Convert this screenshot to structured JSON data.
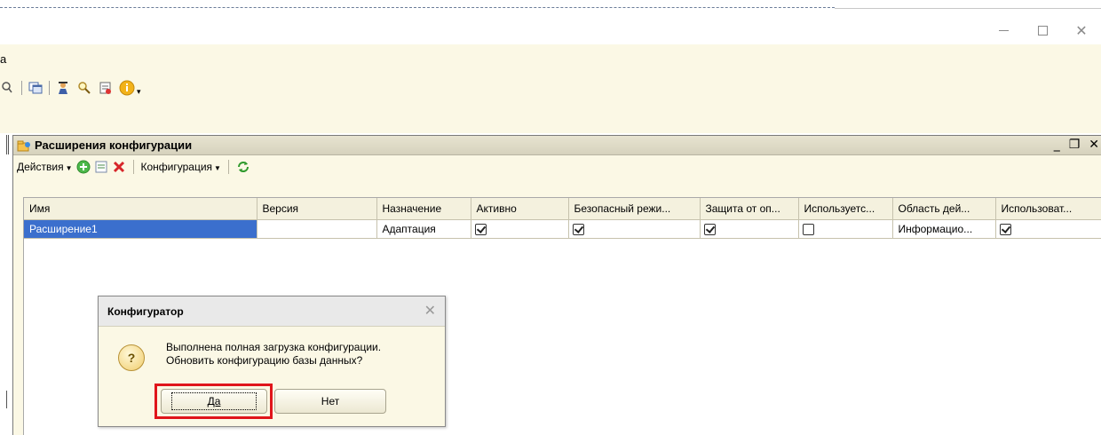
{
  "app": {
    "menu_fragment": "а"
  },
  "extensions_window": {
    "title": "Расширения конфигурации",
    "toolbar": {
      "actions_label": "Действия",
      "configuration_label": "Конфигурация"
    },
    "columns": [
      "Имя",
      "Версия",
      "Назначение",
      "Активно",
      "Безопасный режи...",
      "Защита от оп...",
      "Используетс...",
      "Область дей...",
      "Использоват..."
    ],
    "row": {
      "name": "Расширение1",
      "version": "",
      "purpose": "Адаптация",
      "active": true,
      "safe_mode": true,
      "protection": true,
      "used": false,
      "scope": "Информацио...",
      "use_extra": true
    }
  },
  "dialog": {
    "title": "Конфигуратор",
    "message_line1": "Выполнена полная загрузка конфигурации.",
    "message_line2": "Обновить конфигурацию базы данных?",
    "yes_label": "Да",
    "no_label": "Нет",
    "highlight_color": "#e0151b"
  }
}
